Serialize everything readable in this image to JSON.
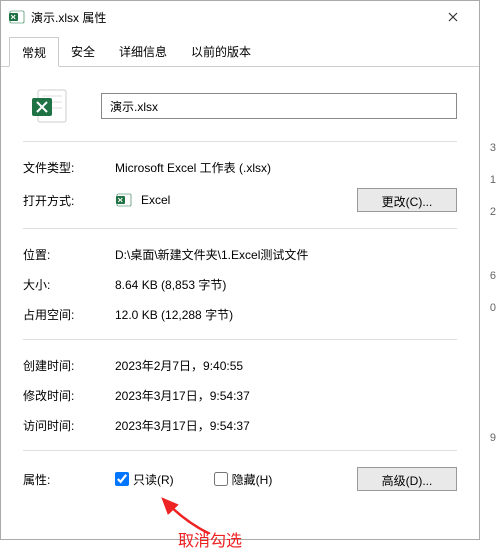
{
  "title": "演示.xlsx 属性",
  "tabs": {
    "general": "常规",
    "security": "安全",
    "details": "详细信息",
    "previous": "以前的版本"
  },
  "filename": "演示.xlsx",
  "rows": {
    "filetype_label": "文件类型:",
    "filetype_value": "Microsoft Excel 工作表 (.xlsx)",
    "openwith_label": "打开方式:",
    "openwith_value": "Excel",
    "change_btn": "更改(C)...",
    "location_label": "位置:",
    "location_value": "D:\\桌面\\新建文件夹\\1.Excel测试文件",
    "size_label": "大小:",
    "size_value": "8.64 KB (8,853 字节)",
    "sizedisk_label": "占用空间:",
    "sizedisk_value": "12.0 KB (12,288 字节)",
    "created_label": "创建时间:",
    "created_value": "2023年2月7日，9:40:55",
    "modified_label": "修改时间:",
    "modified_value": "2023年3月17日，9:54:37",
    "accessed_label": "访问时间:",
    "accessed_value": "2023年3月17日，9:54:37",
    "attr_label": "属性:",
    "readonly_label": "只读(R)",
    "hidden_label": "隐藏(H)",
    "advanced_btn": "高级(D)..."
  },
  "readonly_checked": true,
  "hidden_checked": false,
  "annotation": "取消勾选",
  "edge_numbers": [
    "3",
    "1",
    "2",
    "6",
    "0",
    "9"
  ]
}
